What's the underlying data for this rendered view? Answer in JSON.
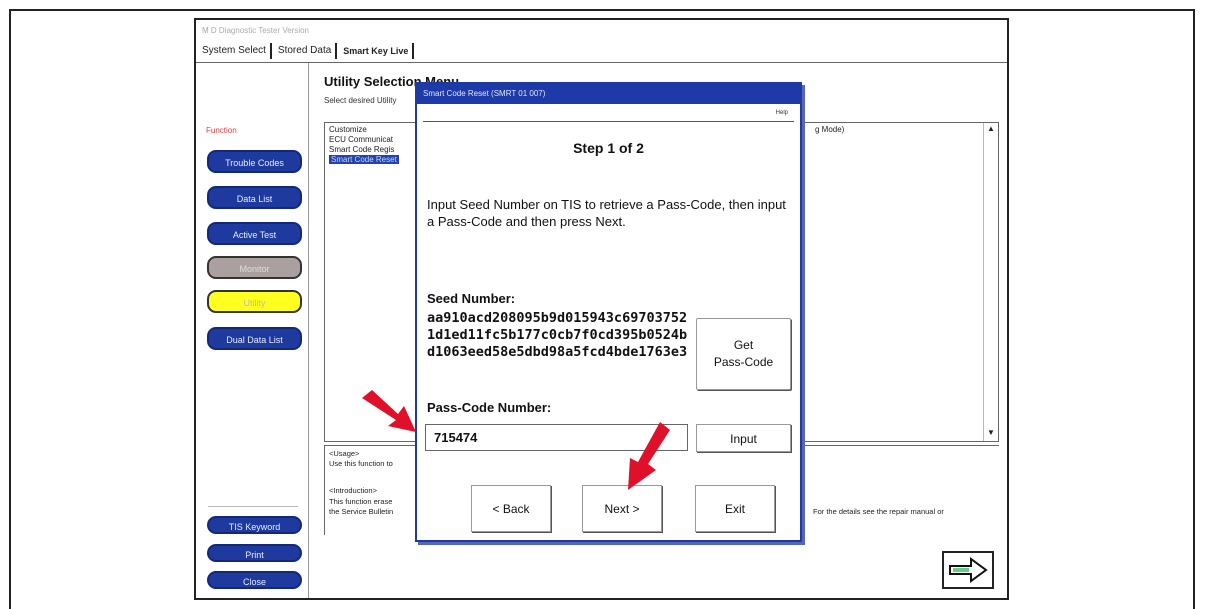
{
  "app": {
    "title": "M D Diagnostic Tester Version",
    "tabs": [
      "System Select",
      "Stored Data",
      "Smart Key Live"
    ]
  },
  "sidebar": {
    "label": "Function",
    "buttons": [
      "Trouble Codes",
      "Data List",
      "Active Test",
      "Monitor",
      "Utility",
      "Dual Data List"
    ],
    "bottom_buttons": [
      "TIS Keyword",
      "Print",
      "Close"
    ]
  },
  "utility": {
    "title": "Utility Selection Menu",
    "subtitle": "Select desired Utility",
    "items": [
      "Customize",
      "ECU Communicat",
      "Smart Code Regis",
      "Smart Code Reset"
    ],
    "selected_index": 3,
    "right_fragment": "g Mode)",
    "usage_heading": "<Usage>",
    "usage_text": "Use this function to",
    "intro_heading": "<Introduction>",
    "intro_text": "This function erase",
    "intro_text2": "the Service Bulletin",
    "intro_right": "For the details see the repair manual or"
  },
  "dialog": {
    "title": "Smart Code Reset (SMRT 01 007)",
    "help": "Help",
    "step": "Step 1 of 2",
    "instructions": "Input Seed Number on TIS to retrieve a Pass-Code, then input a Pass-Code and then press Next.",
    "seed_label": "Seed Number:",
    "seed_value": "aa910acd208095b9d015943c697037521d1ed11fc5b177c0cb7f0cd395b0524bd1063eed58e5dbd98a5fcd4bde1763e3",
    "get_passcode_label_line1": "Get",
    "get_passcode_label_line2": "Pass-Code",
    "passcode_label": "Pass-Code Number:",
    "passcode_value": "715474",
    "input_label": "Input",
    "back_label": "< Back",
    "next_label": "Next >",
    "exit_label": "Exit"
  },
  "colors": {
    "button_blue": "#1e3a9e",
    "utility_yellow": "#ffff20",
    "arrow_red": "#e0102a"
  }
}
